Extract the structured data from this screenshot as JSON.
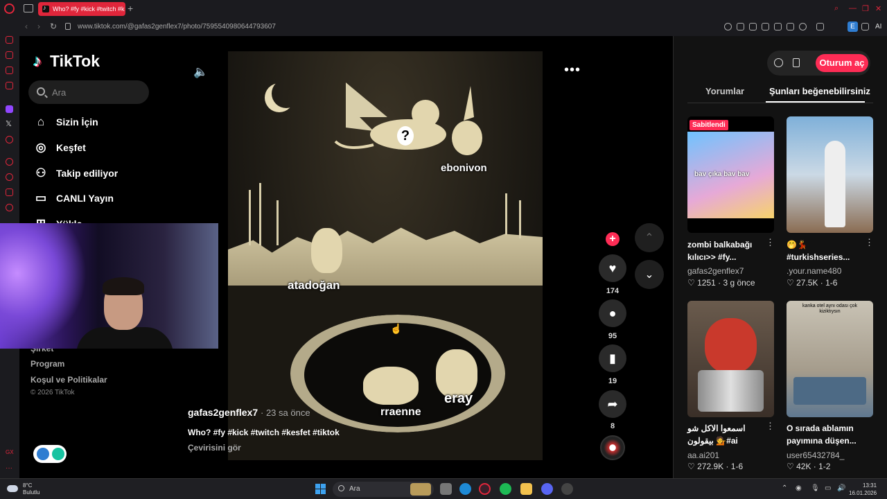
{
  "browser": {
    "tab_title": "Who? #fy #kick #twitch #k",
    "url": "www.tiktok.com/@gafas2genflex7/photo/7595540980644793607",
    "ai_label": "AI",
    "ext_label": "E"
  },
  "tiktok": {
    "logo": "TikTok",
    "search_placeholder": "Ara",
    "menu": [
      {
        "label": "Sizin İçin",
        "icon": "home-icon"
      },
      {
        "label": "Keşfet",
        "icon": "compass-icon"
      },
      {
        "label": "Takip ediliyor",
        "icon": "following-icon"
      },
      {
        "label": "CANLI Yayın",
        "icon": "live-icon"
      },
      {
        "label": "Yükle",
        "icon": "upload-icon"
      }
    ],
    "footer_links": [
      "Şirket",
      "Program",
      "Koşul ve Politikalar"
    ],
    "copyright": "© 2026 TikTok"
  },
  "post": {
    "author": "gafas2genflex7",
    "time": "· 23 sa önce",
    "caption": "Who? #fy #kick #twitch #kesfet #tiktok",
    "translate": "Çevirisini gör",
    "image_labels": [
      "ebonivon",
      "atadoğan",
      "eray",
      "rraenne",
      "?"
    ],
    "likes": "174",
    "comments": "95",
    "saves": "19",
    "shares": "8"
  },
  "right_panel": {
    "login": "Oturum aç",
    "tabs": [
      "Yorumlar",
      "Şunları beğenebilirsiniz"
    ],
    "cards": [
      {
        "badge": "Sabitlendi",
        "thumb_text": "bav çıka bav bav",
        "title": "zombi balkabağı kılıcı>> #fy...",
        "user": "gafas2genflex7",
        "stats": "♡ 1251 · 3 g önce"
      },
      {
        "badge": "",
        "thumb_text": "",
        "title": "🤭💃 #turkishseries...",
        "user": ".your.name480",
        "stats": "♡ 27.5K · 1-6"
      },
      {
        "badge": "",
        "thumb_text": "",
        "title": "اسمعوا الاكل شو بيقولون 💁#ai",
        "user": "aa.ai201",
        "stats": "♡ 272.9K · 1-6"
      },
      {
        "badge": "",
        "thumb_text": "kanka otel aynı odası çok kiziktıysın",
        "title": "O sırada ablamın payımına düşen...",
        "user": "user65432784_",
        "stats": "♡ 42K · 1-2"
      }
    ]
  },
  "taskbar": {
    "temp": "8°C",
    "condition": "Bulutlu",
    "search": "Ara",
    "time": "13:31",
    "date": "16.01.2026"
  }
}
